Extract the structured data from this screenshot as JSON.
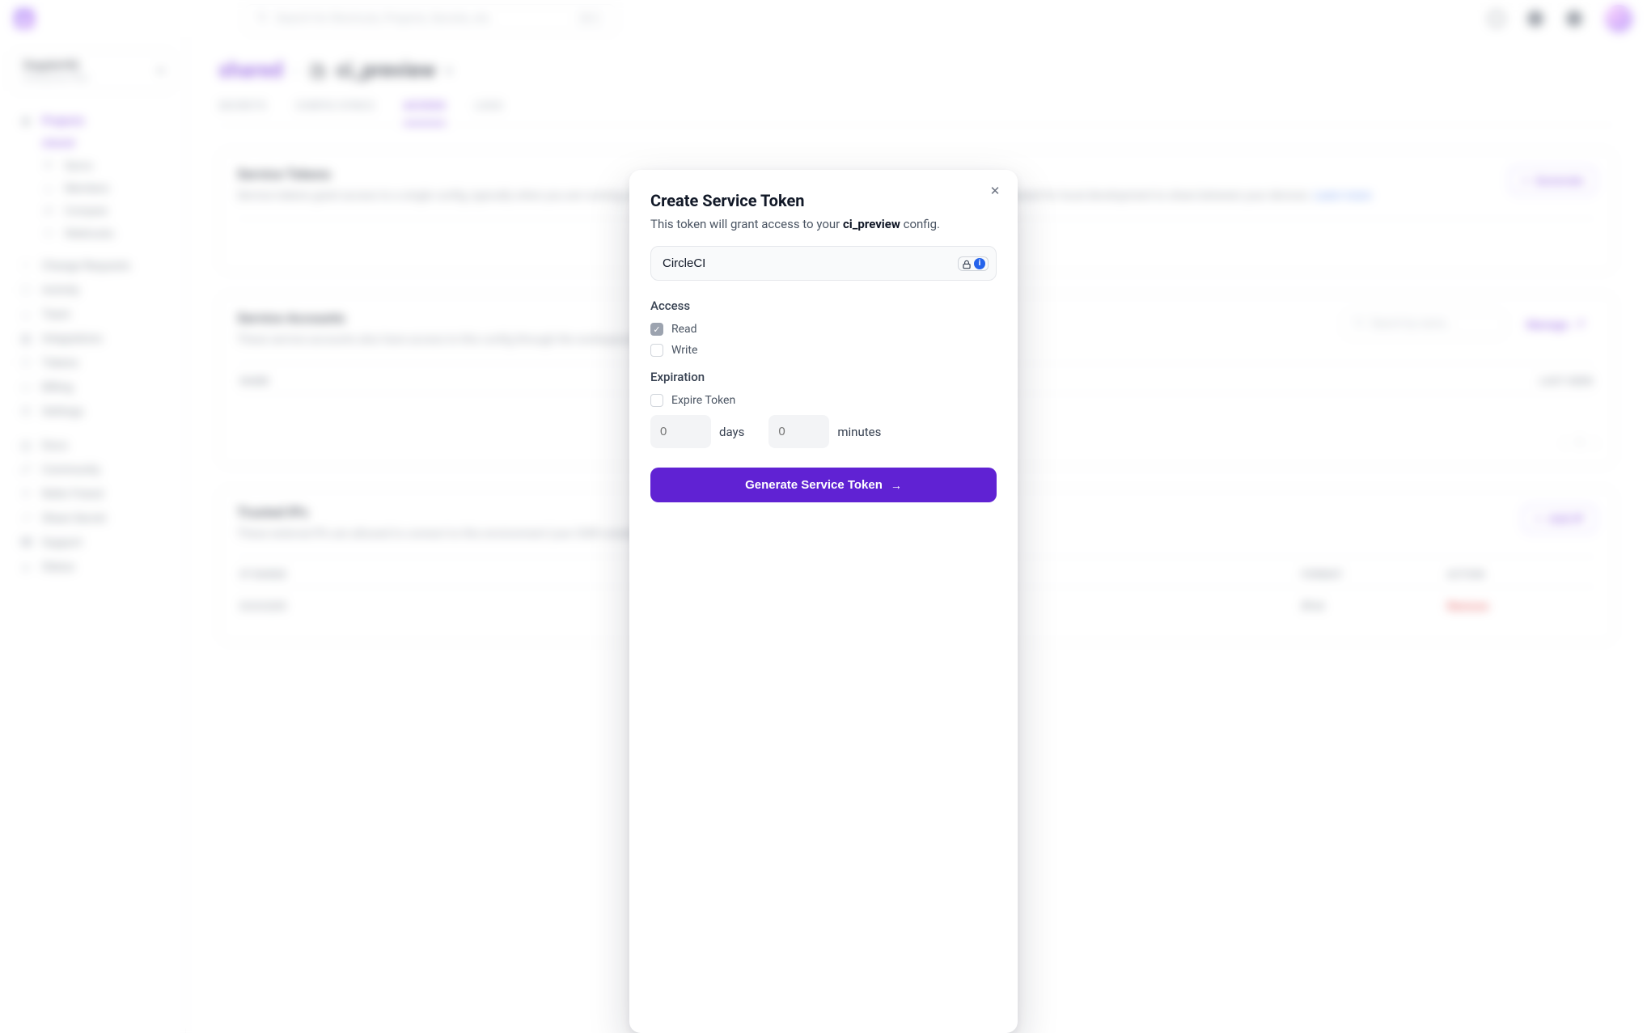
{
  "top": {
    "search_placeholder": "Search for Shortcuts, Projects, Secrets, etc.",
    "shortcut": "⌘ K"
  },
  "org": {
    "name": "DopplerHQ",
    "plan": "Enterprise Plan"
  },
  "nav": {
    "projects": "Projects",
    "projects_child": "shared",
    "project_children": [
      "Syncs",
      "Members",
      "Compare",
      "Webhooks"
    ],
    "items": [
      "Change Requests",
      "Activity",
      "Team",
      "Integrations",
      "Tokens",
      "Billing",
      "Settings"
    ],
    "footer": [
      "Docs",
      "Community",
      "Refer Friend",
      "Share Secret",
      "Support",
      "Status"
    ]
  },
  "breadcrumb": {
    "parent": "shared",
    "config": "ci_preview"
  },
  "tabs": [
    "SECRETS",
    "CONFIG SYNCS",
    "ACCESS",
    "LOGS"
  ],
  "tabs_active_index": 2,
  "cards": {
    "service_tokens": {
      "title": "Service Tokens",
      "desc": "Service tokens grant access to a single config, typically when you are running on a cloud provider like AWS, GCP, Azure, or DigitalOcean. They can also be created for local development to share between your devices.",
      "learn_more": "Learn more",
      "generate": "Generate"
    },
    "service_accounts": {
      "title": "Service Accounts",
      "desc": "These service accounts also have access to this config through the workspace/project roles.",
      "manage": "Manage",
      "search_placeholder": "Search by name...",
      "columns": {
        "name": "NAME",
        "last_seen": "LAST SEEN"
      },
      "pager": {
        "current": "1"
      }
    },
    "trusted_ips": {
      "title": "Trusted IPs",
      "desc": "These external IPs are allowed to connect to this environment (use CIDR notation).",
      "learn_more": "Learn more",
      "add_ip": "Add IP",
      "columns": {
        "range": "IP RANGE",
        "format": "FORMAT",
        "action": "ACTION"
      },
      "row": {
        "range": "0.0.0.0/0",
        "format": "IPv4",
        "action": "Remove"
      }
    }
  },
  "modal": {
    "title": "Create Service Token",
    "subtitle_prefix": "This token will grant access to your ",
    "subtitle_config": "ci_preview",
    "subtitle_suffix": " config.",
    "token_name": "CircleCI",
    "access_label": "Access",
    "access_read": "Read",
    "access_write": "Write",
    "expiration_label": "Expiration",
    "expire_token": "Expire Token",
    "days_unit": "days",
    "minutes_unit": "minutes",
    "days_placeholder": "0",
    "minutes_placeholder": "0",
    "submit": "Generate Service Token"
  }
}
